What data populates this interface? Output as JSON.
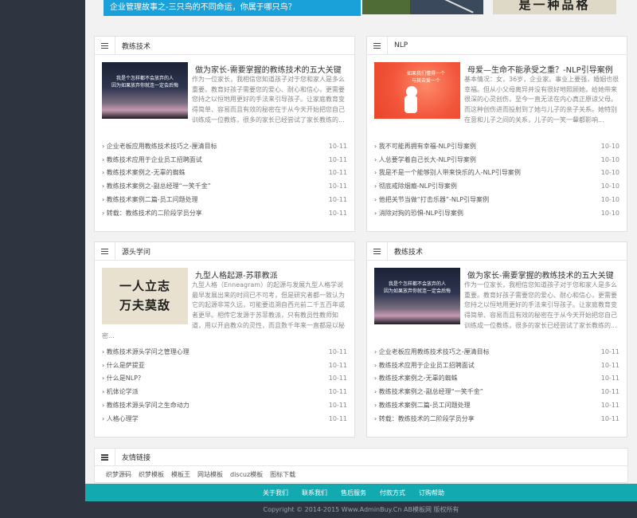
{
  "banner": {
    "headline": "企业管理故事之-三只鸟的不同命运，你属于哪只鸟？",
    "side_text": "是一种品格"
  },
  "panels": [
    {
      "title": "教练技术",
      "thumb_lines": [
        "我是个怎样都不会放弃的人",
        "因为如果放弃你就连一定会后悔"
      ],
      "feature_title": "做为家长-需要掌握的教练技术的五大关键",
      "feature_desc": "作为一位家长，我相信您知道孩子对于您和家人是多么重要。教育好孩子需要您的爱心、耐心和信心，更需要您持之以恒地用更好的手法来引导孩子。让家庭教育变得简单、容易而且有效的秘密在于从今天开始把您自己训练成一位教练，很多的家长已经尝试了家长教练的...",
      "items": [
        {
          "text": "› 企业老板应用教练技术技巧之-厘清目标",
          "date": "10-11"
        },
        {
          "text": "› 教练技术应用于企业员工招聘面试",
          "date": "10-11"
        },
        {
          "text": "› 教练技术案例之-无辜的蜘蛛",
          "date": "10-11"
        },
        {
          "text": "› 教练技术案例之-副总经理“一笑千金”",
          "date": "10-11"
        },
        {
          "text": "› 教练技术案例二篇-员工问题处理",
          "date": "10-11"
        },
        {
          "text": "› 转载：教练技术的二阶段学员分享",
          "date": "10-11"
        }
      ]
    },
    {
      "title": "NLP",
      "thumb_lines": [
        "如果我们懂得一个",
        "与其去爱一个",
        "一切"
      ],
      "feature_title": "母爱—生命不能承受之重？-NLP引导案例",
      "feature_desc": "基本情况：女，36岁，企业家。事业上要强，婚姻也很幸福。但从小父母离异并没有很好地照顾她，给她带来很深的心灵创伤，至今一直无法在内心真正原谅父母。而这种创伤进而投射到了她与儿子的亲子关系。她特别在意和儿子之间的关系，儿子的一笑一颦都影响...",
      "items": [
        {
          "text": "› 我不可能再拥有幸福-NLP引导案例",
          "date": "10-10"
        },
        {
          "text": "› 人总要学着自己长大-NLP引导案例",
          "date": "10-10"
        },
        {
          "text": "› 我是不是一个能够别人带来快乐的人-NLP引导案例",
          "date": "10-10"
        },
        {
          "text": "› 彻底戒除烟瘾-NLP引导案例",
          "date": "10-10"
        },
        {
          "text": "› 他把关节当做“打击乐器”-NLP引导案例",
          "date": "10-10"
        },
        {
          "text": "› 消除对狗的恐惧-NLP引导案例",
          "date": "10-10"
        }
      ]
    },
    {
      "title": "源头学问",
      "thumb_lines": [
        "一人立志",
        "万夫莫敌",
        "志"
      ],
      "feature_title": "九型人格起源-苏菲教派",
      "feature_desc": "九型人格（Enneagram）的起源与发展九型人格学说最早发展出来的时间已不可考，但是研究者都一致认为它的起源非常久远，可能要追溯自西元前二千五百年或者更早。相传它发源于苏菲教派，只有教员性教师知道，用以开启教众的灵性，而且数千年来一直都是以秘密...",
      "items": [
        {
          "text": "› 教练技术源头学问之管理心理",
          "date": "10-11"
        },
        {
          "text": "› 什么是萨提亚",
          "date": "10-11"
        },
        {
          "text": "› 什么是NLP?",
          "date": "10-11"
        },
        {
          "text": "› 机体论学派",
          "date": "10-11"
        },
        {
          "text": "› 教练技术源头学问之生命动力",
          "date": "10-11"
        },
        {
          "text": "› 人格心理学",
          "date": "10-11"
        }
      ]
    },
    {
      "title": "教练技术",
      "thumb_lines": [
        "我是个怎样都不会放弃的人",
        "因为如果放弃你就连一定会后悔"
      ],
      "feature_title": "做为家长-需要掌握的教练技术的五大关键",
      "feature_desc": "作为一位家长，我相信您知道孩子对于您和家人是多么重要。教育好孩子需要您的爱心、耐心和信心，更需要您持之以恒地用更好的手法来引导孩子。让家庭教育变得简单、容易而且有效的秘密在于从今天开始把您自己训练成一位教练，很多的家长已经尝试了家长教练的...",
      "items": [
        {
          "text": "› 企业老板应用教练技术技巧之-厘清目标",
          "date": "10-11"
        },
        {
          "text": "› 教练技术应用于企业员工招聘面试",
          "date": "10-11"
        },
        {
          "text": "› 教练技术案例之-无辜的蜘蛛",
          "date": "10-11"
        },
        {
          "text": "› 教练技术案例之-副总经理“一笑千金”",
          "date": "10-11"
        },
        {
          "text": "› 教练技术案例二篇-员工问题处理",
          "date": "10-11"
        },
        {
          "text": "› 转载：教练技术的二阶段学员分享",
          "date": "10-11"
        }
      ]
    }
  ],
  "friend_links": {
    "title": "友情链接",
    "links": [
      "织梦源码",
      "织梦模板",
      "模板王",
      "网站模板",
      "discuz模板",
      "图标下载"
    ]
  },
  "footer": {
    "nav": [
      "关于我们",
      "联系我们",
      "售后服务",
      "付款方式",
      "订购帮助"
    ],
    "copyright": "Copyright © 2014-2015 Www.AdminBuy.Cn AB模板网 版权所有"
  },
  "colors": {
    "sidebar_bg": "#2f3540",
    "banner_blue": "#1ba1d9",
    "footer_teal": "#12a9b0"
  }
}
